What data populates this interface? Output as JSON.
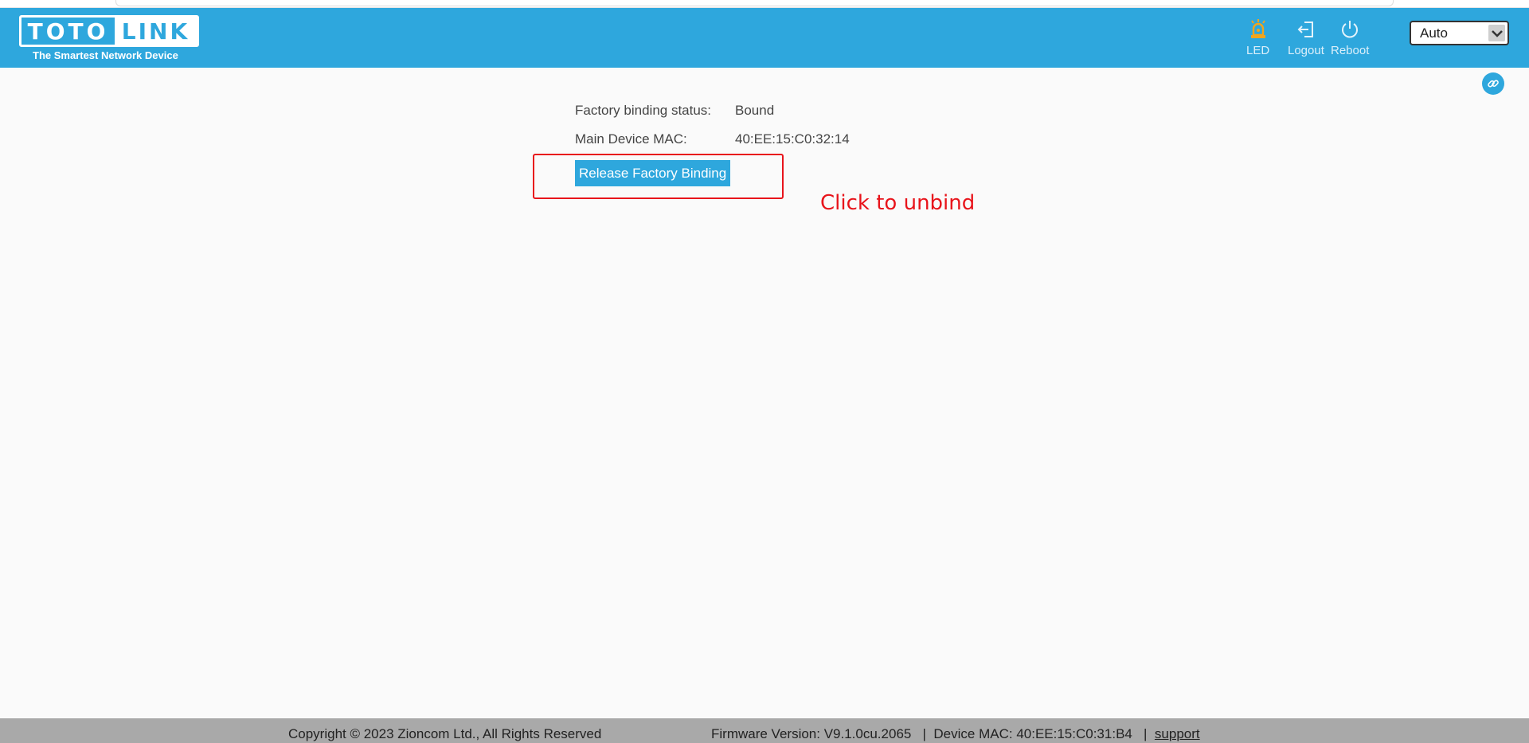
{
  "header": {
    "logo_left": "TOTO",
    "logo_right": "LINK",
    "tagline": "The Smartest Network Device",
    "led_label": "LED",
    "logout_label": "Logout",
    "reboot_label": "Reboot",
    "language_selected": "Auto"
  },
  "main": {
    "binding_status_label": "Factory binding status:",
    "binding_status_value": "Bound",
    "main_mac_label": "Main Device MAC:",
    "main_mac_value": "40:EE:15:C0:32:14",
    "release_button_label": "Release Factory Binding"
  },
  "annotation": {
    "text": "Click to unbind",
    "color": "#e8141b"
  },
  "footer": {
    "copyright": "Copyright © 2023 Zioncom Ltd., All Rights Reserved",
    "firmware": "Firmware Version: V9.1.0cu.2065",
    "device_mac": "Device MAC: 40:EE:15:C0:31:B4",
    "support_link": "support"
  },
  "colors": {
    "brand": "#2ea7dd",
    "led_icon": "#f2a51c",
    "footer_bg": "#a9a9a9"
  }
}
